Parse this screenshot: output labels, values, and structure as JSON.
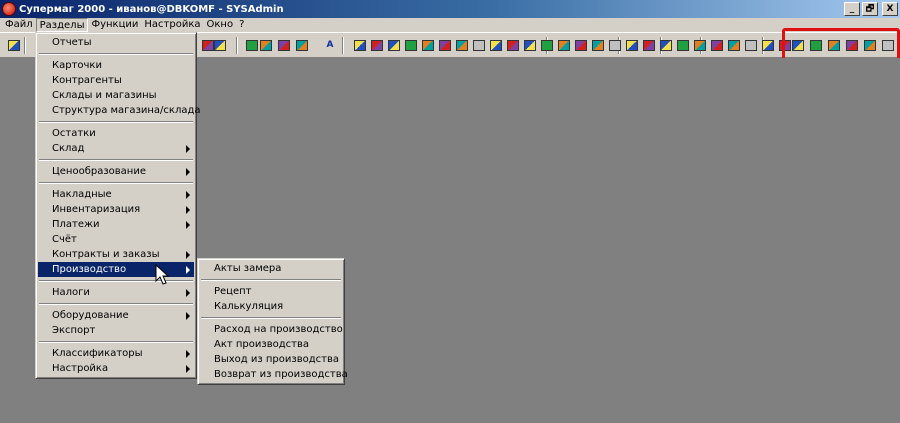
{
  "window": {
    "title": "Супермаг 2000 - иванов@DBKOMF - SYSAdmin",
    "buttons": [
      "_",
      "🗗",
      "X"
    ]
  },
  "menubar": [
    "Файл",
    "Разделы",
    "Функции",
    "Настройка",
    "Окно",
    "?"
  ],
  "active_menu": "Разделы",
  "sections_menu": [
    {
      "label": "Отчеты",
      "submenu": false
    },
    {
      "sep": true
    },
    {
      "label": "Карточки",
      "submenu": false
    },
    {
      "label": "Контрагенты",
      "submenu": false
    },
    {
      "label": "Склады и магазины",
      "submenu": false
    },
    {
      "label": "Структура магазина/склада",
      "submenu": false
    },
    {
      "sep": true
    },
    {
      "label": "Остатки",
      "submenu": false
    },
    {
      "label": "Склад",
      "submenu": true
    },
    {
      "sep": true
    },
    {
      "label": "Ценообразование",
      "submenu": true
    },
    {
      "sep": true
    },
    {
      "label": "Накладные",
      "submenu": true
    },
    {
      "label": "Инвентаризация",
      "submenu": true
    },
    {
      "label": "Платежи",
      "submenu": true
    },
    {
      "label": "Счёт",
      "submenu": false
    },
    {
      "label": "Контракты и заказы",
      "submenu": true
    },
    {
      "label": "Производство",
      "submenu": true,
      "selected": true
    },
    {
      "sep": true
    },
    {
      "label": "Налоги",
      "submenu": true
    },
    {
      "sep": true
    },
    {
      "label": "Оборудование",
      "submenu": true
    },
    {
      "label": "Экспорт",
      "submenu": false
    },
    {
      "sep": true
    },
    {
      "label": "Классификаторы",
      "submenu": true
    },
    {
      "label": "Настройка",
      "submenu": true
    }
  ],
  "production_submenu": [
    {
      "label": "Акты замера"
    },
    {
      "sep": true
    },
    {
      "label": "Рецепт"
    },
    {
      "label": "Калькуляция"
    },
    {
      "sep": true
    },
    {
      "label": "Расход на производство"
    },
    {
      "label": "Акт производства"
    },
    {
      "label": "Выход из производства"
    },
    {
      "label": "Возврат из производства"
    }
  ],
  "toolbar": {
    "text_button": "A",
    "icons": [
      "open-icon",
      "report-icon",
      "chart-icon",
      "calendar-icon",
      "note-icon",
      "text-icon",
      "document-icon",
      "document-add-icon",
      "document-edit-icon",
      "tree-icon",
      "green-bar-icon",
      "save-icon",
      "truck-icon",
      "window-icon",
      "list-icon",
      "network-icon",
      "transfer-icon",
      "swap-icon",
      "swap-alt-icon",
      "split-icon",
      "arrow-up-icon",
      "arrow-down-icon",
      "count-icon",
      "delete-icon",
      "mark-icon",
      "cross-icon",
      "print-icon",
      "filter-icon",
      "filter-edit-icon",
      "filter-red-icon",
      "filter-green-icon",
      "filter-clear-icon"
    ]
  }
}
